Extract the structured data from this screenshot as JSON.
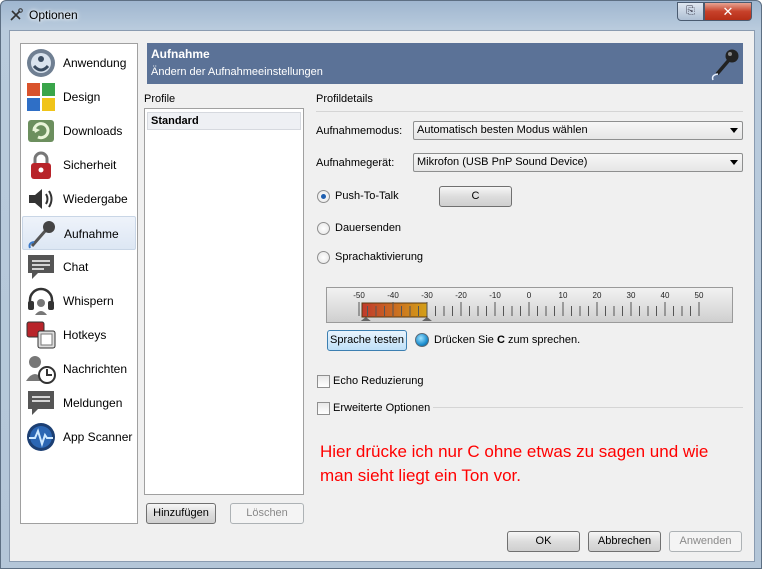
{
  "window": {
    "title": "Optionen",
    "help_glyph": "⎘",
    "close_glyph": "✕"
  },
  "sidebar": {
    "items": [
      {
        "label": "Anwendung",
        "icon": "application-icon"
      },
      {
        "label": "Design",
        "icon": "design-icon"
      },
      {
        "label": "Downloads",
        "icon": "downloads-icon"
      },
      {
        "label": "Sicherheit",
        "icon": "security-icon"
      },
      {
        "label": "Wiedergabe",
        "icon": "playback-icon"
      },
      {
        "label": "Aufnahme",
        "icon": "microphone-icon",
        "active": true
      },
      {
        "label": "Chat",
        "icon": "chat-icon"
      },
      {
        "label": "Whispern",
        "icon": "headset-icon"
      },
      {
        "label": "Hotkeys",
        "icon": "hotkeys-icon"
      },
      {
        "label": "Nachrichten",
        "icon": "messages-icon"
      },
      {
        "label": "Meldungen",
        "icon": "notifications-icon"
      },
      {
        "label": "App Scanner",
        "icon": "app-scanner-icon"
      }
    ]
  },
  "header": {
    "title": "Aufnahme",
    "subtitle": "Ändern der Aufnahmeeinstellungen"
  },
  "profiles": {
    "label": "Profile",
    "items": [
      "Standard"
    ],
    "add_button": "Hinzufügen",
    "delete_button": "Löschen"
  },
  "details": {
    "label": "Profildetails",
    "mode_label": "Aufnahmemodus:",
    "mode_value": "Automatisch besten Modus wählen",
    "device_label": "Aufnahmegerät:",
    "device_value": "Mikrofon (USB PnP Sound Device)",
    "ptt_label": "Push-To-Talk",
    "ptt_key": "C",
    "continuous_label": "Dauersenden",
    "voice_label": "Sprachaktivierung",
    "selected_mode": "Push-To-Talk",
    "meter": {
      "ticks": [
        "-50",
        "-40",
        "-30",
        "-20",
        "-10",
        "0",
        "10",
        "20",
        "30",
        "40",
        "50"
      ],
      "level_db": -30,
      "level_colors": [
        "#c0392b",
        "#d4a017"
      ]
    },
    "test_button": "Sprache testen",
    "hint_prefix": "Drücken Sie ",
    "hint_key": "C",
    "hint_suffix": " zum sprechen.",
    "echo_label": "Echo Reduzierung",
    "echo_checked": false,
    "advanced_label": "Erweiterte Optionen",
    "advanced_checked": false
  },
  "annotation": "Hier drücke ich nur C ohne etwas zu sagen und wie man sieht liegt ein Ton vor.",
  "footer": {
    "ok": "OK",
    "cancel": "Abbrechen",
    "apply": "Anwenden"
  },
  "colors": {
    "header_bg": "#5b7297",
    "annotation": "#ff0000"
  }
}
